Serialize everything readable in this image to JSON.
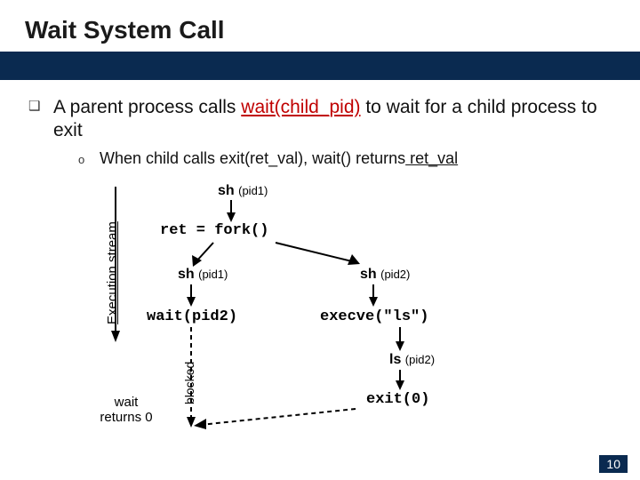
{
  "title": "Wait System Call",
  "bullet_glyph": "❑",
  "bullet1_pre": "A parent process calls ",
  "bullet1_fn": "wait(child_pid)",
  "bullet1_post": " to wait for a child process to exit",
  "sub_glyph": "o",
  "bullet2_pre": "When child calls exit(ret_val), wait() returns",
  "bullet2_fn": " ret_val",
  "axis_label": "Execution  stream",
  "blocked_label": "blocked",
  "wait_returns_line1": "wait",
  "wait_returns_line2": "returns 0",
  "nodes": {
    "sh_top": "sh",
    "pid1a": "(pid1)",
    "fork": "ret = fork()",
    "sh_left": "sh",
    "pid1b": "(pid1)",
    "sh_right": "sh",
    "pid2a": "(pid2)",
    "wait_call": "wait(pid2)",
    "execve": "execve(\"ls\")",
    "ls": "ls",
    "pid2b": "(pid2)",
    "exit": "exit(0)"
  },
  "page_number": "10"
}
